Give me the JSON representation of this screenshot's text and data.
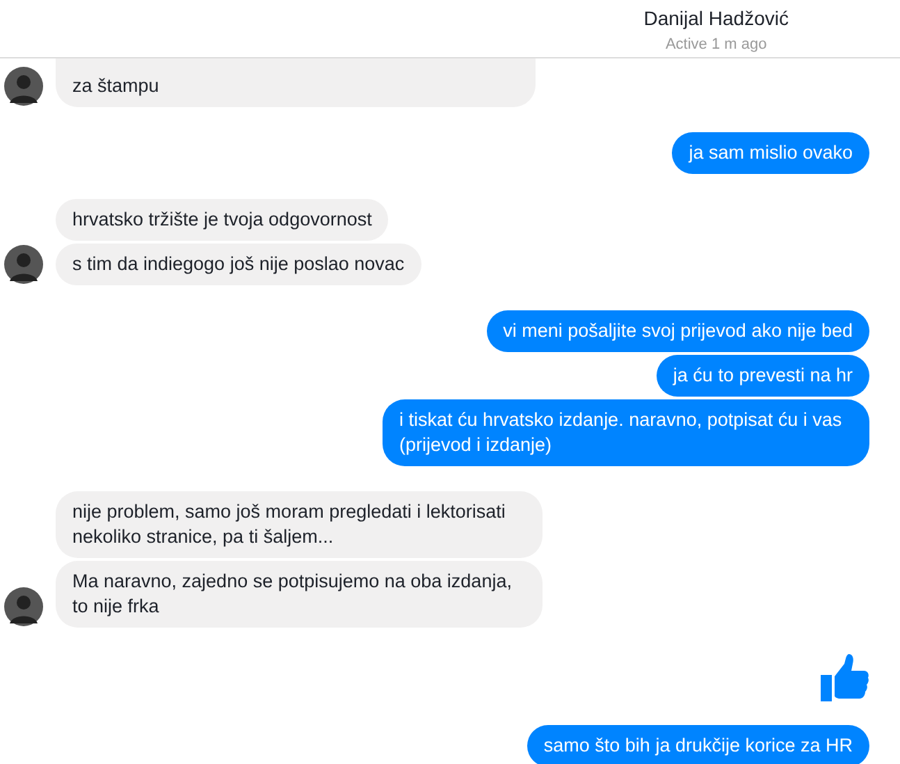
{
  "header": {
    "name": "Danijal Hadžović",
    "status": "Active 1 m ago"
  },
  "groups": [
    {
      "kind": "incoming",
      "messages": [
        {
          "kind": "text",
          "text": "za štampu"
        }
      ]
    },
    {
      "kind": "outgoing",
      "messages": [
        {
          "kind": "text",
          "text": "ja sam mislio ovako"
        }
      ]
    },
    {
      "kind": "incoming",
      "messages": [
        {
          "kind": "text",
          "text": "hrvatsko tržište je tvoja odgovornost"
        },
        {
          "kind": "text",
          "text": "s tim da indiegogo još nije poslao novac"
        }
      ]
    },
    {
      "kind": "outgoing",
      "messages": [
        {
          "kind": "text",
          "text": "vi meni pošaljite svoj prijevod ako nije bed"
        },
        {
          "kind": "text",
          "text": "ja ću to prevesti na hr"
        },
        {
          "kind": "text",
          "text": "i tiskat ću hrvatsko izdanje. naravno, potpisat ću i vas (prijevod i izdanje)"
        }
      ]
    },
    {
      "kind": "incoming",
      "messages": [
        {
          "kind": "text",
          "text": "nije problem, samo još moram pregledati i lektorisati nekoliko stranice, pa ti šaljem..."
        },
        {
          "kind": "text",
          "text": "Ma naravno, zajedno se potpisujemo na oba izdanja, to nije frka"
        }
      ]
    },
    {
      "kind": "outgoing",
      "messages": [
        {
          "kind": "like"
        },
        {
          "kind": "text",
          "text": "samo što bih ja drukčije korice za HR"
        }
      ]
    }
  ]
}
